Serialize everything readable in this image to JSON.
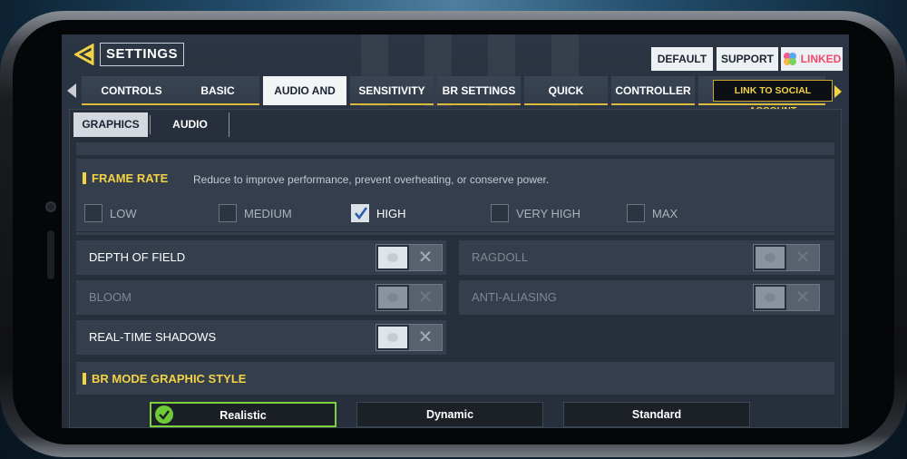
{
  "header": {
    "title": "SETTINGS",
    "buttons": {
      "default": "DEFAULT",
      "support": "SUPPORT",
      "linked": "LINKED"
    }
  },
  "tabs": [
    {
      "label": "CONTROLS"
    },
    {
      "label": "BASIC"
    },
    {
      "label": "AUDIO AND GRAPHICS",
      "active": true
    },
    {
      "label": "SENSITIVITY"
    },
    {
      "label": "BR SETTINGS"
    },
    {
      "label": "QUICK MESSAGE"
    },
    {
      "label": "CONTROLLER"
    }
  ],
  "tooltip": "LINK TO SOCIAL ACCOUNT",
  "subtabs": {
    "graphics": "GRAPHICS",
    "audio": "AUDIO"
  },
  "frame_rate": {
    "title": "FRAME RATE",
    "hint": "Reduce to improve performance, prevent overheating, or conserve power.",
    "options": [
      {
        "label": "LOW",
        "checked": false
      },
      {
        "label": "MEDIUM",
        "checked": false
      },
      {
        "label": "HIGH",
        "checked": true
      },
      {
        "label": "VERY HIGH",
        "checked": false
      },
      {
        "label": "MAX",
        "checked": false
      }
    ]
  },
  "toggles": {
    "depth_of_field": "DEPTH OF FIELD",
    "ragdoll": "RAGDOLL",
    "bloom": "BLOOM",
    "anti_aliasing": "ANTI-ALIASING",
    "real_time_shadows": "REAL-TIME SHADOWS"
  },
  "br_mode": {
    "title": "BR MODE GRAPHIC STYLE",
    "options": {
      "realistic": "Realistic",
      "dynamic": "Dynamic",
      "standard": "Standard"
    },
    "selected": "Realistic"
  },
  "colors": {
    "accent_yellow": "#f3d244",
    "selected_green": "#7cd13a"
  }
}
